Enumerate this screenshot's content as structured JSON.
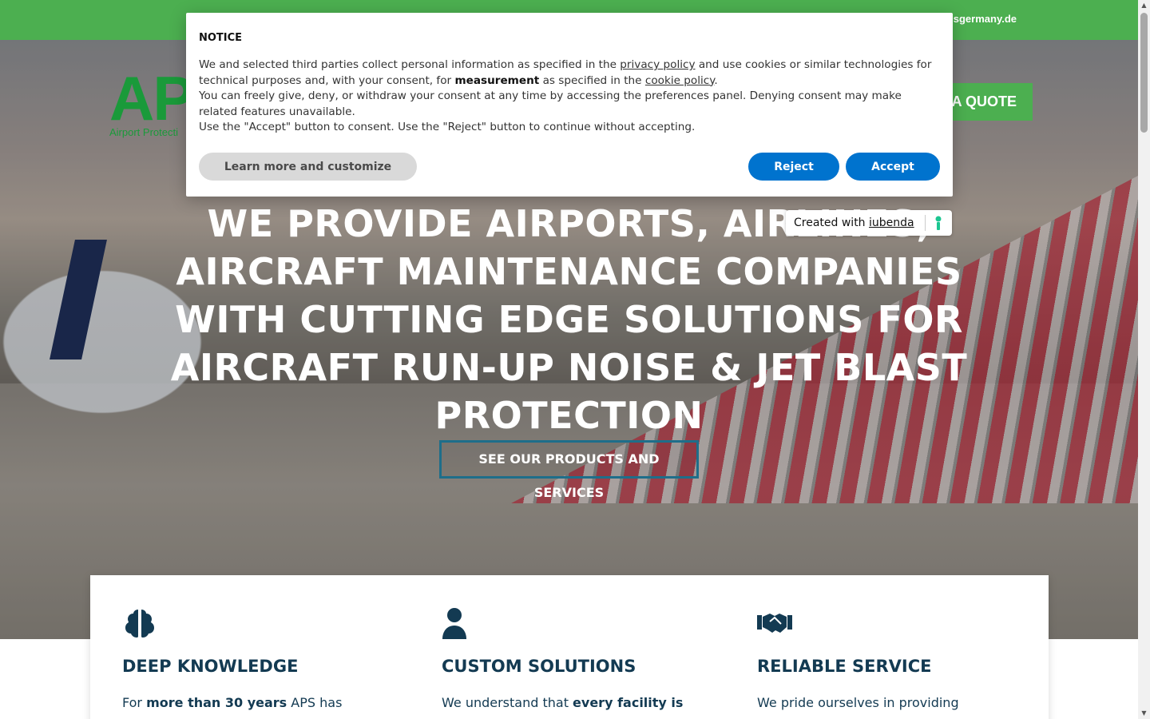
{
  "topbar": {
    "email": "sgermany.de"
  },
  "logo": {
    "mark": "AP",
    "subtitle": "Airport Protecti"
  },
  "header": {
    "quote_label": "A QUOTE"
  },
  "hero": {
    "headline": "WE PROVIDE AIRPORTS, AIRLINES, AIRCRAFT MAINTENANCE COMPANIES WITH CUTTING EDGE SOLUTIONS FOR AIRCRAFT RUN-UP NOISE & JET BLAST PROTECTION",
    "cta_label": "SEE OUR PRODUCTS AND SERVICES"
  },
  "cards": [
    {
      "title": "DEEP KNOWLEDGE",
      "text_pre": "For ",
      "text_bold": "more than 30 years",
      "text_post": " APS has",
      "icon": "brain-icon"
    },
    {
      "title": "CUSTOM SOLUTIONS",
      "text_pre": "We understand that ",
      "text_bold": "every facility is",
      "text_post": "",
      "icon": "user-icon"
    },
    {
      "title": "RELIABLE SERVICE",
      "text_pre": "We pride ourselves in providing",
      "text_bold": "",
      "text_post": "",
      "icon": "handshake-icon"
    }
  ],
  "notice": {
    "title": "NOTICE",
    "p1_a": "We and selected third parties collect personal information as specified in the ",
    "privacy_link": "privacy policy",
    "p1_b": " and use cookies or similar technologies for technical purposes and, with your consent, for ",
    "measurement": "measurement",
    "p1_c": " as specified in the ",
    "cookie_link": "cookie policy",
    "p1_d": ".",
    "p2": "You can freely give, deny, or withdraw your consent at any time by accessing the preferences panel. Denying consent may make related features unavailable.",
    "p3": "Use the \"Accept\" button to consent. Use the \"Reject\" button to continue without accepting.",
    "learn_label": "Learn more and customize",
    "reject_label": "Reject",
    "accept_label": "Accept"
  },
  "iubenda": {
    "prefix": "Created with ",
    "link": "iubenda"
  },
  "colors": {
    "brand_green": "#4caf50",
    "logo_green": "#1a9a3a",
    "consent_blue": "#0073ce",
    "navy": "#133a52"
  }
}
